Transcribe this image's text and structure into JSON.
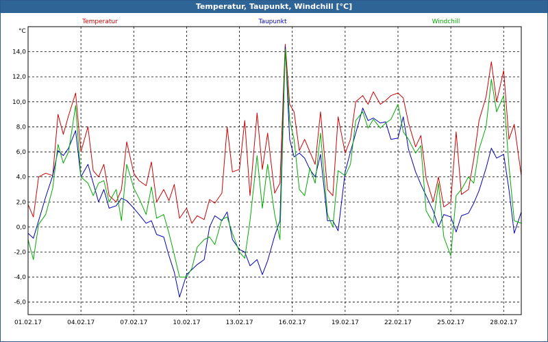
{
  "window": {
    "title": "Temperatur, Taupunkt, Windchill [°C]"
  },
  "colors": {
    "titlebar": "#2f6496",
    "grid": "#000000",
    "temperature": "#cc0000",
    "dewpoint": "#0000bb",
    "windchill": "#00aa00"
  },
  "chart_data": {
    "type": "line",
    "title": "Temperatur, Taupunkt, Windchill [°C]",
    "ylabel": "°C",
    "ylim": [
      -7,
      16
    ],
    "xlim": [
      1,
      29
    ],
    "grid": true,
    "legend_placement": "top",
    "y_ticks": [
      -6,
      -4,
      -2,
      0,
      2,
      4,
      6,
      8,
      10,
      12,
      14
    ],
    "y_tick_labels": [
      "-6,0",
      "-4,0",
      "-2,0",
      "0,0",
      "2,0",
      "4,0",
      "6,0",
      "8,0",
      "10,0",
      "12,0",
      "14,0"
    ],
    "x_ticks": [
      1,
      4,
      7,
      10,
      13,
      16,
      19,
      22,
      25,
      28
    ],
    "x_tick_labels": [
      "01.02.17",
      "04.02.17",
      "07.02.17",
      "10.02.17",
      "13.02.17",
      "16.02.17",
      "19.02.17",
      "22.02.17",
      "25.02.17",
      "28.02.17"
    ],
    "series": [
      {
        "name": "Temperatur",
        "color": "#cc0000",
        "x": [
          1.0,
          1.3,
          1.6,
          2.0,
          2.4,
          2.7,
          3.0,
          3.3,
          3.7,
          4.0,
          4.4,
          4.7,
          5.0,
          5.3,
          5.6,
          6.0,
          6.3,
          6.6,
          7.0,
          7.3,
          7.7,
          8.0,
          8.3,
          8.7,
          9.0,
          9.3,
          9.6,
          10.0,
          10.3,
          10.6,
          11.0,
          11.3,
          11.6,
          12.0,
          12.3,
          12.6,
          13.0,
          13.3,
          13.6,
          14.0,
          14.3,
          14.6,
          15.0,
          15.3,
          15.6,
          15.85,
          16.1,
          16.4,
          16.7,
          17.0,
          17.3,
          17.6,
          18.0,
          18.3,
          18.6,
          19.0,
          19.3,
          19.6,
          20.0,
          20.3,
          20.6,
          21.0,
          21.3,
          21.6,
          22.0,
          22.3,
          22.6,
          23.0,
          23.3,
          23.6,
          24.0,
          24.3,
          24.6,
          25.0,
          25.3,
          25.6,
          26.0,
          26.3,
          26.6,
          27.0,
          27.3,
          27.6,
          28.0,
          28.3,
          28.6,
          29.0
        ],
        "y": [
          1.8,
          0.8,
          4.0,
          4.3,
          4.1,
          9.0,
          7.4,
          8.9,
          10.7,
          6.0,
          8.0,
          4.5,
          4.0,
          5.0,
          2.5,
          2.0,
          3.0,
          6.8,
          4.3,
          3.7,
          3.3,
          5.2,
          2.0,
          3.0,
          2.1,
          3.4,
          0.7,
          1.5,
          0.3,
          0.9,
          0.6,
          2.2,
          1.9,
          2.7,
          8.0,
          4.4,
          4.6,
          8.5,
          2.5,
          9.1,
          4.6,
          7.5,
          2.7,
          3.5,
          14.6,
          9.8,
          9.2,
          6.1,
          7.0,
          6.0,
          5.0,
          9.2,
          3.0,
          2.5,
          8.8,
          5.9,
          7.0,
          10.0,
          10.5,
          9.8,
          10.8,
          9.8,
          10.1,
          10.5,
          10.7,
          10.3,
          8.3,
          6.4,
          7.3,
          3.9,
          2.0,
          4.0,
          1.6,
          2.0,
          7.6,
          2.6,
          3.0,
          5.4,
          8.5,
          10.4,
          13.2,
          10.0,
          12.5,
          7.0,
          8.2,
          4.1
        ]
      },
      {
        "name": "Taupunkt",
        "color": "#0000bb",
        "x": [
          1.0,
          1.3,
          1.6,
          2.0,
          2.4,
          2.7,
          3.0,
          3.3,
          3.7,
          4.0,
          4.4,
          4.7,
          5.0,
          5.3,
          5.6,
          6.0,
          6.3,
          6.6,
          7.0,
          7.3,
          7.7,
          8.0,
          8.3,
          8.7,
          9.0,
          9.3,
          9.6,
          10.0,
          10.3,
          10.6,
          11.0,
          11.3,
          11.6,
          12.0,
          12.3,
          12.6,
          13.0,
          13.3,
          13.6,
          14.0,
          14.3,
          14.6,
          15.0,
          15.3,
          15.6,
          15.85,
          16.1,
          16.4,
          16.7,
          17.0,
          17.3,
          17.6,
          18.0,
          18.3,
          18.6,
          19.0,
          19.3,
          19.6,
          20.0,
          20.3,
          20.6,
          21.0,
          21.3,
          21.6,
          22.0,
          22.3,
          22.6,
          23.0,
          23.3,
          23.6,
          24.0,
          24.3,
          24.6,
          25.0,
          25.3,
          25.6,
          26.0,
          26.3,
          26.6,
          27.0,
          27.3,
          27.6,
          28.0,
          28.3,
          28.6,
          29.0
        ],
        "y": [
          -0.5,
          -0.9,
          0.5,
          2.4,
          4.1,
          6.1,
          5.7,
          6.3,
          7.7,
          4.0,
          5.0,
          3.5,
          2.0,
          3.0,
          1.5,
          1.7,
          2.3,
          2.1,
          1.5,
          1.0,
          0.3,
          0.5,
          -0.6,
          -0.8,
          -2.3,
          -3.6,
          -5.6,
          -3.8,
          -3.4,
          -3.0,
          -2.6,
          0.0,
          0.9,
          0.5,
          1.2,
          -1.0,
          -1.8,
          -2.0,
          -3.1,
          -2.6,
          -3.8,
          -2.7,
          -0.7,
          0.5,
          14.4,
          7.0,
          5.6,
          5.9,
          5.5,
          4.6,
          4.0,
          5.8,
          0.5,
          0.5,
          -0.3,
          4.4,
          6.0,
          7.5,
          9.5,
          8.5,
          8.7,
          8.3,
          8.4,
          7.0,
          7.1,
          8.8,
          6.2,
          4.4,
          3.4,
          2.5,
          1.3,
          0.0,
          1.0,
          0.8,
          -0.4,
          0.9,
          1.1,
          1.9,
          2.9,
          4.7,
          6.3,
          5.5,
          5.8,
          3.0,
          -0.5,
          1.2
        ]
      },
      {
        "name": "Windchill",
        "color": "#00aa00",
        "x": [
          1.0,
          1.3,
          1.6,
          2.0,
          2.4,
          2.7,
          3.0,
          3.3,
          3.7,
          4.0,
          4.4,
          4.7,
          5.0,
          5.3,
          5.6,
          6.0,
          6.3,
          6.6,
          7.0,
          7.3,
          7.7,
          8.0,
          8.3,
          8.7,
          9.0,
          9.3,
          9.6,
          10.0,
          10.3,
          10.6,
          11.0,
          11.3,
          11.6,
          12.0,
          12.3,
          12.6,
          13.0,
          13.3,
          13.6,
          14.0,
          14.3,
          14.6,
          15.0,
          15.3,
          15.6,
          15.85,
          16.1,
          16.4,
          16.7,
          17.0,
          17.3,
          17.6,
          18.0,
          18.3,
          18.6,
          19.0,
          19.3,
          19.6,
          20.0,
          20.3,
          20.6,
          21.0,
          21.3,
          21.6,
          22.0,
          22.3,
          22.6,
          23.0,
          23.3,
          23.6,
          24.0,
          24.3,
          24.6,
          25.0,
          25.3,
          25.6,
          26.0,
          26.3,
          26.6,
          27.0,
          27.3,
          27.6,
          28.0,
          28.3,
          28.6,
          29.0
        ],
        "y": [
          -1.0,
          -2.6,
          0.2,
          1.0,
          3.1,
          6.6,
          5.1,
          6.0,
          9.7,
          4.0,
          3.5,
          2.5,
          3.5,
          3.7,
          2.0,
          3.0,
          0.5,
          5.0,
          3.1,
          2.3,
          1.0,
          3.2,
          0.7,
          1.0,
          -0.5,
          -2.2,
          -4.0,
          -4.0,
          -3.3,
          -1.6,
          -1.0,
          -0.8,
          -1.4,
          0.6,
          0.8,
          -0.5,
          -2.0,
          -2.5,
          0.5,
          5.7,
          1.5,
          5.0,
          1.0,
          -1.0,
          14.2,
          8.5,
          7.0,
          3.0,
          2.5,
          4.7,
          3.5,
          7.5,
          1.0,
          0.0,
          4.5,
          4.1,
          5.0,
          8.5,
          9.2,
          7.9,
          8.6,
          7.9,
          8.3,
          8.6,
          9.8,
          7.6,
          7.0,
          5.9,
          6.5,
          1.3,
          0.3,
          3.5,
          -0.8,
          -2.3,
          2.5,
          3.0,
          4.0,
          3.5,
          6.2,
          8.0,
          11.8,
          9.2,
          10.5,
          4.9,
          0.5,
          0.3
        ]
      }
    ]
  }
}
